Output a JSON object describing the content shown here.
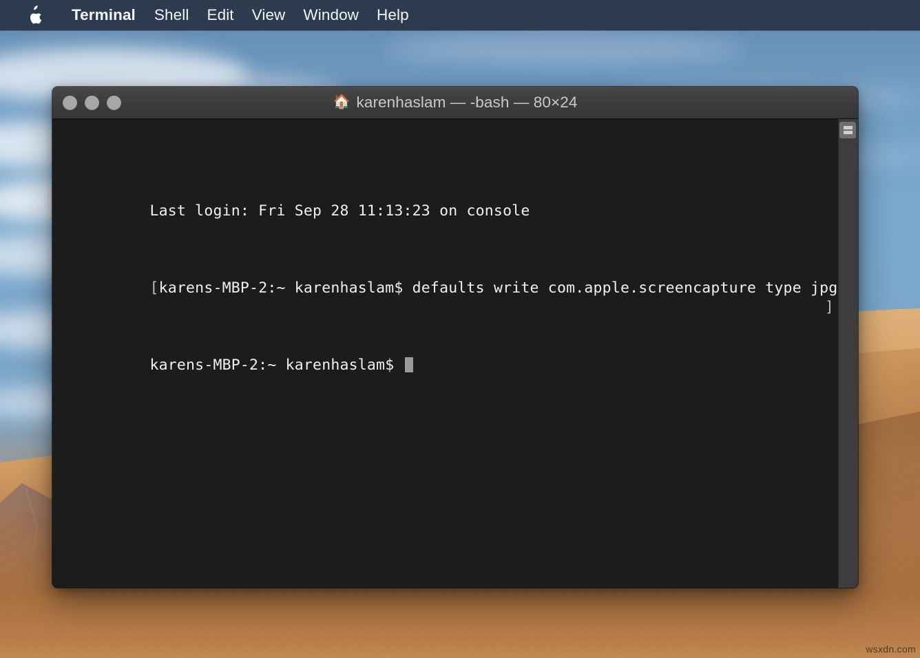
{
  "menubar": {
    "apple_icon": "apple-logo-icon",
    "items": [
      {
        "label": "Terminal",
        "bold": true
      },
      {
        "label": "Shell",
        "bold": false
      },
      {
        "label": "Edit",
        "bold": false
      },
      {
        "label": "View",
        "bold": false
      },
      {
        "label": "Window",
        "bold": false
      },
      {
        "label": "Help",
        "bold": false
      }
    ],
    "background_color": "#2c3b4d",
    "text_color": "#f2f4f6"
  },
  "window": {
    "title": "karenhaslam — -bash — 80×24",
    "title_icon": "🏠",
    "title_icon_name": "home-folder-icon",
    "traffic_lights": [
      {
        "name": "close-button",
        "color": "#a8a8a8"
      },
      {
        "name": "minimize-button",
        "color": "#a8a8a8"
      },
      {
        "name": "zoom-button",
        "color": "#a8a8a8"
      }
    ],
    "background_color": "#1c1c1c",
    "titlebar_color": "#3c3c3c",
    "text_color": "#f0f0f0",
    "split_pane_button_label": "split-pane"
  },
  "terminal": {
    "lines": [
      {
        "prefix": "",
        "text": "Last login: Fri Sep 28 11:13:23 on console",
        "suffix": "",
        "cursor": false
      },
      {
        "prefix": "[",
        "text": "karens-MBP-2:~ karenhaslam$ defaults write com.apple.screencapture type jpg",
        "suffix": "]",
        "cursor": false
      },
      {
        "prefix": "",
        "text": "karens-MBP-2:~ karenhaslam$ ",
        "suffix": "",
        "cursor": true
      }
    ],
    "columns": 80,
    "rows": 24,
    "shell": "-bash",
    "user": "karenhaslam",
    "host": "karens-MBP-2",
    "cwd": "~",
    "command": "defaults write com.apple.screencapture type jpg"
  },
  "desktop": {
    "wallpaper_name": "mojave-desert",
    "sky_color": "#7ba5c8",
    "sand_color": "#c08a52"
  },
  "watermark": {
    "text": "wsxdn.com"
  }
}
